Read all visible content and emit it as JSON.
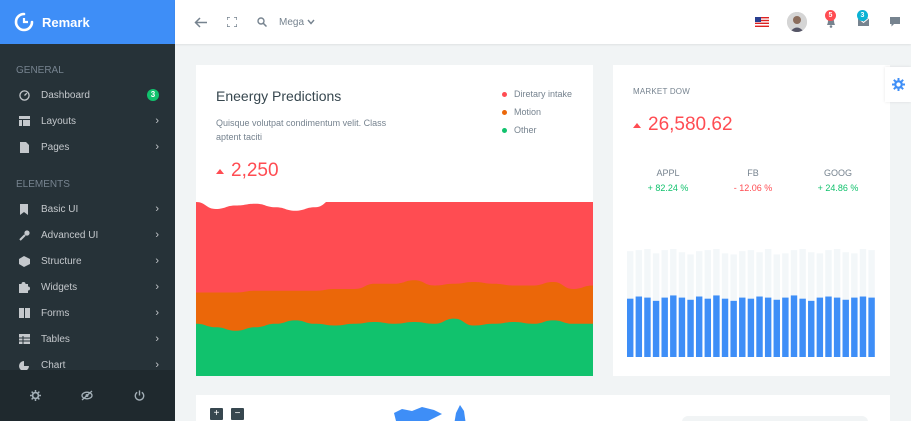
{
  "brand": {
    "name": "Remark"
  },
  "sidebar": {
    "sections": [
      {
        "title": "GENERAL"
      },
      {
        "title": "ELEMENTS"
      }
    ],
    "general_items": [
      {
        "label": "Dashboard",
        "icon": "dashboard-icon",
        "badge": "3"
      },
      {
        "label": "Layouts",
        "icon": "layouts-icon"
      },
      {
        "label": "Pages",
        "icon": "pages-icon"
      }
    ],
    "element_items": [
      {
        "label": "Basic UI",
        "icon": "bookmark-icon"
      },
      {
        "label": "Advanced UI",
        "icon": "wrench-icon"
      },
      {
        "label": "Structure",
        "icon": "structure-icon"
      },
      {
        "label": "Widgets",
        "icon": "puzzle-icon"
      },
      {
        "label": "Forms",
        "icon": "book-icon"
      },
      {
        "label": "Tables",
        "icon": "table-icon"
      },
      {
        "label": "Chart",
        "icon": "chart-icon"
      }
    ],
    "footer_icons": [
      "settings-icon",
      "eye-slash-icon",
      "power-icon"
    ]
  },
  "topbar": {
    "mega_label": "Mega",
    "notifications_count": "5",
    "messages_count": "3"
  },
  "colors": {
    "primary": "#3e8ef7",
    "sidebar": "#263238",
    "red": "#ff4c52",
    "orange": "#eb6709",
    "green": "#11c26d",
    "bar_blue": "#3e8ef7",
    "bar_grey": "#f3f7f9"
  },
  "energy_card": {
    "title": "Eneergy Predictions",
    "subtitle": "Quisque volutpat condimentum velit. Class aptent taciti",
    "value": "2,250",
    "legend": [
      {
        "label": "Diretary intake",
        "color": "#ff4c52"
      },
      {
        "label": "Motion",
        "color": "#eb6709"
      },
      {
        "label": "Other",
        "color": "#11c26d"
      }
    ]
  },
  "market_card": {
    "label": "MARKET DOW",
    "value": "26,580.62",
    "tickers": [
      {
        "name": "APPL",
        "change": "+ 82.24 %",
        "color": "#11c26d"
      },
      {
        "name": "FB",
        "change": "- 12.06 %",
        "color": "#ff4c52"
      },
      {
        "name": "GOOG",
        "change": "+ 24.86 %",
        "color": "#11c26d"
      }
    ]
  },
  "chart_data": [
    {
      "type": "area",
      "series": [
        {
          "name": "Other",
          "values": [
            30,
            28,
            26,
            28,
            30,
            32,
            30,
            29,
            30,
            31,
            30,
            31,
            30,
            33,
            29,
            30,
            31,
            30,
            32,
            30,
            30
          ]
        },
        {
          "name": "Motion",
          "values": [
            18,
            20,
            22,
            21,
            19,
            17,
            19,
            21,
            20,
            22,
            23,
            24,
            22,
            20,
            25,
            23,
            21,
            22,
            22,
            20,
            22
          ]
        },
        {
          "name": "Diretary intake",
          "values": [
            52,
            48,
            50,
            50,
            48,
            46,
            48,
            52,
            54,
            50,
            48,
            49,
            50,
            52,
            48,
            50,
            52,
            51,
            50,
            52,
            50
          ]
        }
      ]
    },
    {
      "type": "bar",
      "series": [
        {
          "name": "value",
          "values": [
            54,
            56,
            55,
            52,
            55,
            57,
            55,
            53,
            56,
            54,
            57,
            54,
            52,
            55,
            54,
            56,
            55,
            53,
            55,
            57,
            54,
            52,
            55,
            56,
            55,
            53,
            55,
            56,
            55
          ]
        },
        {
          "name": "max",
          "values": [
            98,
            99,
            100,
            96,
            99,
            100,
            97,
            95,
            98,
            99,
            100,
            96,
            95,
            98,
            99,
            97,
            100,
            95,
            96,
            99,
            100,
            97,
            96,
            99,
            100,
            97,
            96,
            100,
            99
          ]
        }
      ]
    }
  ]
}
